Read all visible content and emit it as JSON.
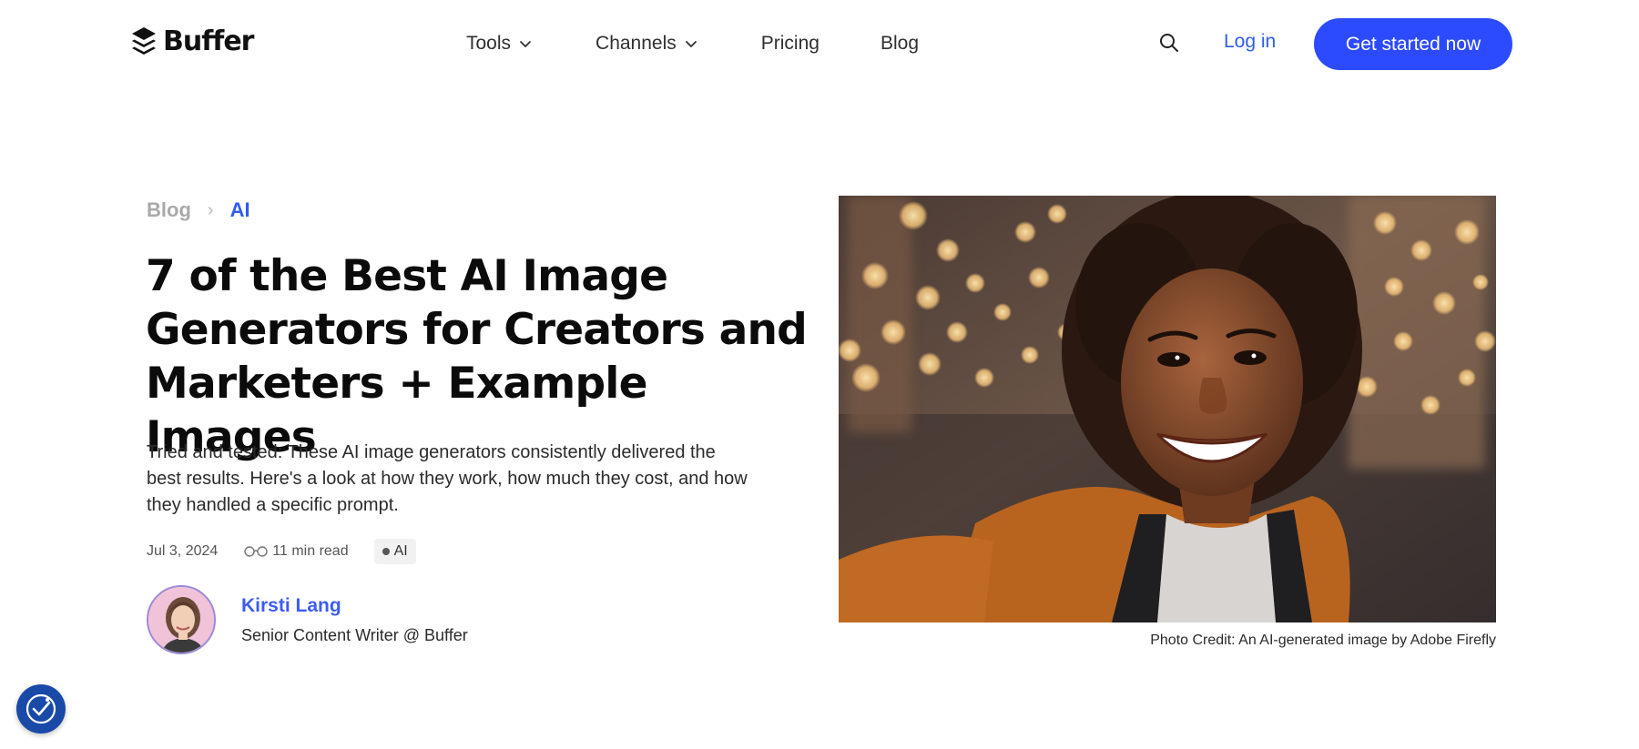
{
  "header": {
    "brand": "Buffer",
    "nav": [
      {
        "label": "Tools",
        "has_dropdown": true
      },
      {
        "label": "Channels",
        "has_dropdown": true
      },
      {
        "label": "Pricing",
        "has_dropdown": false
      },
      {
        "label": "Blog",
        "has_dropdown": false
      }
    ],
    "search_icon": "search-icon",
    "login_label": "Log in",
    "cta_label": "Get started now",
    "colors": {
      "accent": "#2c4bff",
      "link": "#2d5cf2"
    }
  },
  "article": {
    "breadcrumb": {
      "parent": "Blog",
      "separator": "›",
      "current": "AI"
    },
    "title": "7 of the Best AI Image Generators for Creators and Marketers + Example Images",
    "subtitle": "Tried and tested: These AI image generators consistently delivered the best results. Here's a look at how they work, how much they cost, and how they handled a specific prompt.",
    "date": "Jul 3, 2024",
    "read_time": "11 min read",
    "tag": "AI",
    "author": {
      "name": "Kirsti Lang",
      "role": "Senior Content Writer @ Buffer"
    },
    "image_caption": "Photo Credit: An AI-generated image by Adobe Firefly"
  }
}
